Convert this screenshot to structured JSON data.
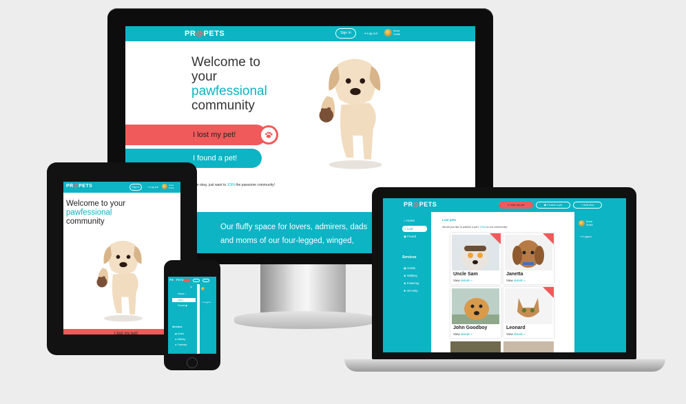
{
  "brand": {
    "logo_pre": "PR",
    "logo_at": "@",
    "logo_post": "PETS",
    "accent": "#0cb4c4",
    "alert": "#f05a5a"
  },
  "header": {
    "sign_in": "Sign In",
    "logout": "Log out",
    "user_first": "Anna",
    "user_last": "Smith"
  },
  "hero": {
    "line1": "Welcome to",
    "line2": "your",
    "line3": "pawfessional",
    "line4": "community",
    "tablet_line1": "Welcome to your",
    "lost_button": "I lost my pet!",
    "found_button": "I found a pet!",
    "join_pre": "I'm okay, just want to",
    "join_link": "JOIN",
    "join_post": "the pawsome community!",
    "tagline1": "Our fluffy space for lovers, admirers, dads",
    "tagline2": "and moms of our four-legged, winged,"
  },
  "laptop": {
    "lost_btn": "I lost my pet",
    "found_btn": "I found a pet",
    "add_new": "Add new",
    "nav": [
      "Home",
      "Lost",
      "Found"
    ],
    "services_title": "Services",
    "services": [
      "Hotels",
      "Walking",
      "Fostering",
      "Vet Help"
    ],
    "breadcrumb": "Lost pets",
    "question_pre": "Would you like to publish a pet?",
    "question_link": "JOIN",
    "question_post": "to our community!",
    "view_label": "View",
    "details_label": "details",
    "pets": [
      "Uncle Sam",
      "Janetta",
      "John Goodboy",
      "Leonard"
    ],
    "user_first": "Anna",
    "user_last": "Smith",
    "logout": "Logout"
  },
  "phone": {
    "nav": [
      "Home",
      "Lost",
      "Found"
    ],
    "services_title": "Services",
    "services": [
      "Hotels",
      "Walking",
      "Fostering"
    ],
    "logout": "Logout"
  }
}
